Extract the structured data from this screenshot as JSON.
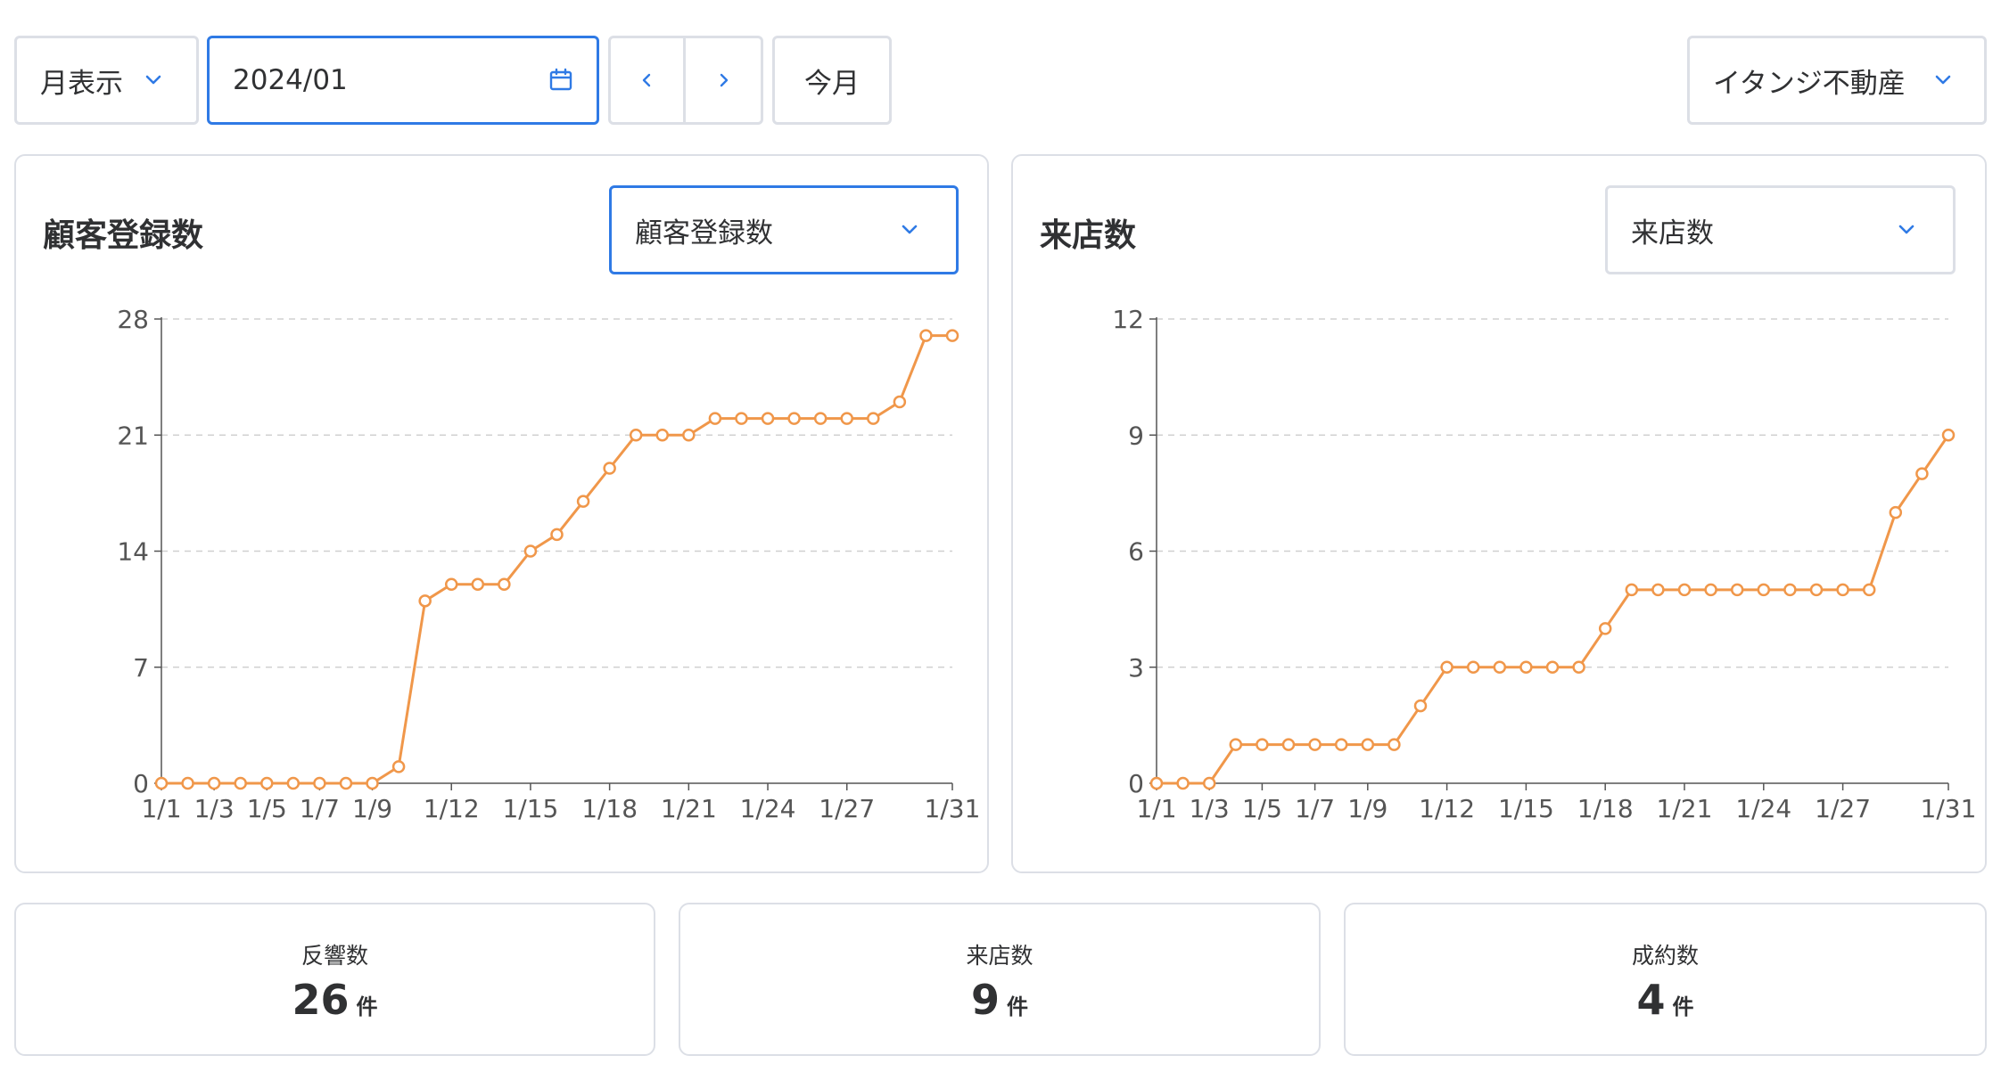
{
  "toolbar": {
    "view_mode": "月表示",
    "date_value": "2024/01",
    "prev_label": "‹",
    "next_label": "›",
    "today_label": "今月",
    "store": "イタンジ不動産"
  },
  "colors": {
    "accent": "#2f7ae5",
    "line": "#f0974a",
    "border": "#dcdfe6",
    "grid": "#d0d0d0"
  },
  "charts": {
    "left": {
      "title": "顧客登録数",
      "select_value": "顧客登録数"
    },
    "right": {
      "title": "来店数",
      "select_value": "来店数"
    }
  },
  "chart_data": [
    {
      "type": "line",
      "title": "顧客登録数",
      "x": [
        "1/1",
        "1/2",
        "1/3",
        "1/4",
        "1/5",
        "1/6",
        "1/7",
        "1/8",
        "1/9",
        "1/10",
        "1/11",
        "1/12",
        "1/13",
        "1/14",
        "1/15",
        "1/16",
        "1/17",
        "1/18",
        "1/19",
        "1/20",
        "1/21",
        "1/22",
        "1/23",
        "1/24",
        "1/25",
        "1/26",
        "1/27",
        "1/28",
        "1/29",
        "1/30",
        "1/31"
      ],
      "x_tick_labels": [
        "1/1",
        "1/3",
        "1/5",
        "1/7",
        "1/9",
        "1/12",
        "1/15",
        "1/18",
        "1/21",
        "1/24",
        "1/27",
        "1/31"
      ],
      "values": [
        0,
        0,
        0,
        0,
        0,
        0,
        0,
        0,
        0,
        1,
        11,
        12,
        12,
        12,
        14,
        15,
        17,
        19,
        21,
        21,
        21,
        22,
        22,
        22,
        22,
        22,
        22,
        22,
        23,
        27,
        27
      ],
      "y_ticks": [
        0,
        7,
        14,
        21,
        28
      ],
      "ylim": [
        0,
        28
      ],
      "grid": "horizontal-dashed",
      "color": "#f0974a"
    },
    {
      "type": "line",
      "title": "来店数",
      "x": [
        "1/1",
        "1/2",
        "1/3",
        "1/4",
        "1/5",
        "1/6",
        "1/7",
        "1/8",
        "1/9",
        "1/10",
        "1/11",
        "1/12",
        "1/13",
        "1/14",
        "1/15",
        "1/16",
        "1/17",
        "1/18",
        "1/19",
        "1/20",
        "1/21",
        "1/22",
        "1/23",
        "1/24",
        "1/25",
        "1/26",
        "1/27",
        "1/28",
        "1/29",
        "1/30",
        "1/31"
      ],
      "x_tick_labels": [
        "1/1",
        "1/3",
        "1/5",
        "1/7",
        "1/9",
        "1/12",
        "1/15",
        "1/18",
        "1/21",
        "1/24",
        "1/27",
        "1/31"
      ],
      "values": [
        0,
        0,
        0,
        1,
        1,
        1,
        1,
        1,
        1,
        1,
        2,
        3,
        3,
        3,
        3,
        3,
        3,
        4,
        5,
        5,
        5,
        5,
        5,
        5,
        5,
        5,
        5,
        5,
        7,
        8,
        9
      ],
      "y_ticks": [
        0,
        3,
        6,
        9,
        12
      ],
      "ylim": [
        0,
        12
      ],
      "grid": "horizontal-dashed",
      "color": "#f0974a"
    }
  ],
  "stats": [
    {
      "label": "反響数",
      "value": "26",
      "unit": "件"
    },
    {
      "label": "来店数",
      "value": "9",
      "unit": "件"
    },
    {
      "label": "成約数",
      "value": "4",
      "unit": "件"
    }
  ]
}
